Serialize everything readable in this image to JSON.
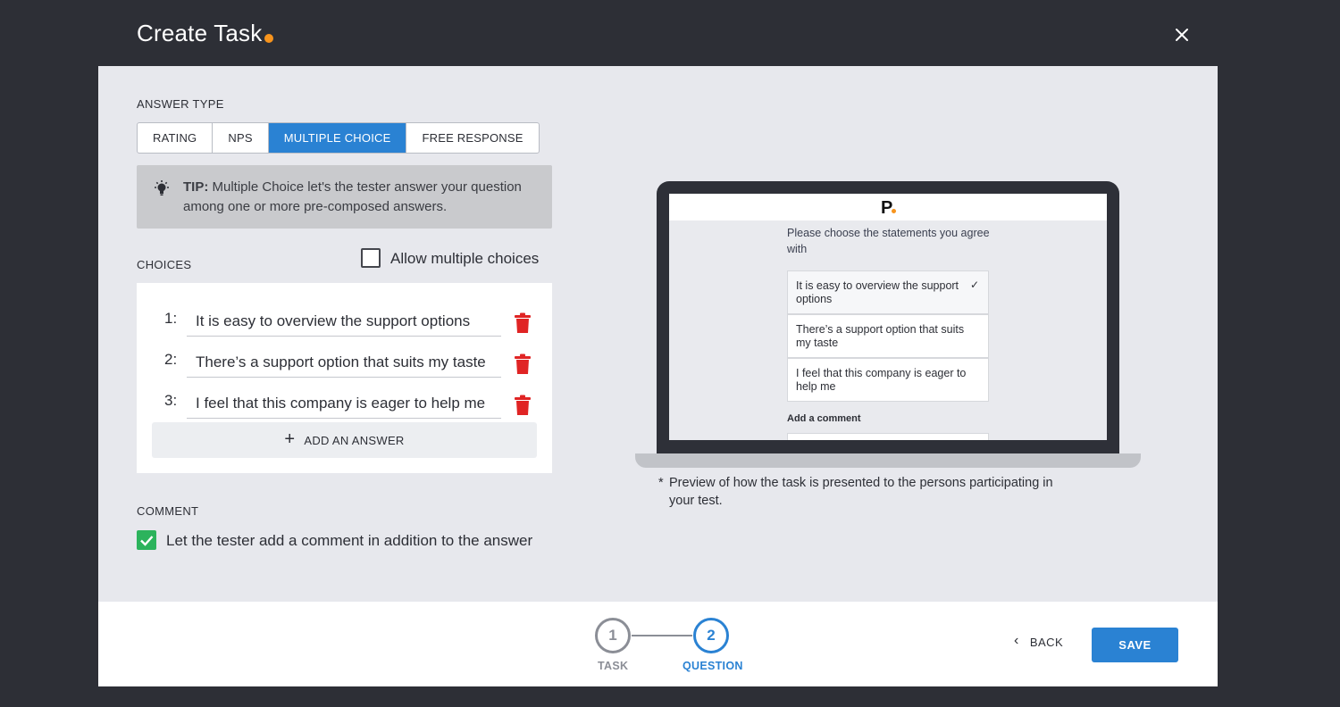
{
  "header": {
    "title": "Create Task"
  },
  "answer_type": {
    "label": "ANSWER TYPE",
    "options": [
      "RATING",
      "NPS",
      "MULTIPLE CHOICE",
      "FREE RESPONSE"
    ],
    "selected": "MULTIPLE CHOICE"
  },
  "tip": {
    "prefix": "TIP:",
    "text": " Multiple Choice let's the tester answer your question among one or more pre-composed answers."
  },
  "choices": {
    "label": "CHOICES",
    "allow_multiple_label": "Allow multiple choices",
    "allow_multiple_checked": false,
    "items": [
      {
        "num": "1:",
        "value": "It is easy to overview the support options"
      },
      {
        "num": "2:",
        "value": "There’s a support option that suits my taste"
      },
      {
        "num": "3:",
        "value": "I feel that this company is eager to help me"
      }
    ],
    "add_label": "ADD AN ANSWER"
  },
  "comment": {
    "label": "COMMENT",
    "checkbox_label": "Let the tester add a comment in addition to the answer",
    "checked": true
  },
  "preview": {
    "logo": "P",
    "question": "Please choose the statements you agree with",
    "options": [
      "It is easy to overview the support options",
      "There’s a support option that suits my taste",
      "I feel that this company is eager to help me"
    ],
    "selected_check": "✓",
    "comment_label": "Add a comment",
    "note_star": "*",
    "note": "Preview of how the task is presented to the persons participating in your test."
  },
  "footer": {
    "steps": [
      {
        "number": "1",
        "label": "TASK"
      },
      {
        "number": "2",
        "label": "QUESTION"
      }
    ],
    "back_label": "BACK",
    "save_label": "SAVE"
  },
  "colors": {
    "accent": "#2a82d3",
    "brand_dot": "#f7941d",
    "delete": "#e02424",
    "check_green": "#2cb35c"
  }
}
